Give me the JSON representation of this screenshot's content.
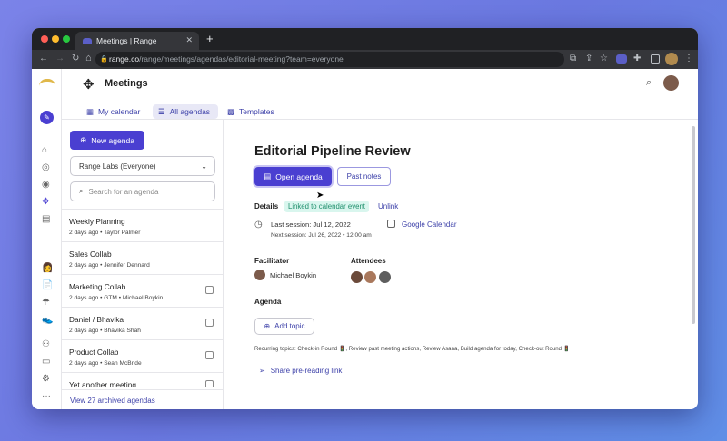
{
  "browser": {
    "tab_title": "Meetings | Range",
    "url_host": "range.co",
    "url_path": "/range/meetings/agendas/editorial-meeting?team=everyone"
  },
  "app": {
    "title": "Meetings"
  },
  "nav_tabs": [
    {
      "label": "My calendar"
    },
    {
      "label": "All agendas"
    },
    {
      "label": "Templates"
    }
  ],
  "sidebar": {
    "new_agenda_label": "New agenda",
    "team_select": "Range Labs (Everyone)",
    "search_placeholder": "Search for an agenda",
    "items": [
      {
        "name": "Weekly Planning",
        "meta": "2 days ago • Taylor Palmer"
      },
      {
        "name": "Sales Collab",
        "meta": "2 days ago • Jennifer Dennard"
      },
      {
        "name": "Marketing Collab",
        "meta": "2 days ago • GTM • Michael Boykin"
      },
      {
        "name": "Daniel / Bhavika",
        "meta": "2 days ago • Bhavika Shah"
      },
      {
        "name": "Product Collab",
        "meta": "2 days ago • Sean McBride"
      },
      {
        "name": "Yet another meeting",
        "meta": ""
      }
    ],
    "archived_link": "View 27 archived agendas"
  },
  "agenda": {
    "title": "Editorial Pipeline Review",
    "open_agenda_label": "Open agenda",
    "past_notes_label": "Past notes",
    "details_label": "Details",
    "linked_badge": "Linked to calendar event",
    "unlink_label": "Unlink",
    "last_session": "Last session: Jul 12, 2022",
    "next_session": "Next session: Jul 26, 2022 • 12:00 am",
    "calendar_link": "Google Calendar",
    "facilitator_label": "Facilitator",
    "facilitator_name": "Michael Boykin",
    "attendees_label": "Attendees",
    "agenda_label": "Agenda",
    "add_topic_label": "Add topic",
    "recurring_topics": "Recurring topics: Check-in Round 🚦, Review past meeting actions, Review Asana, Build agenda for today, Check-out Round 🚦",
    "share_label": "Share pre-reading link"
  },
  "colors": {
    "accent": "#4a3fd1",
    "badge_bg": "#d9f6ee",
    "badge_text": "#1f8f6c"
  }
}
